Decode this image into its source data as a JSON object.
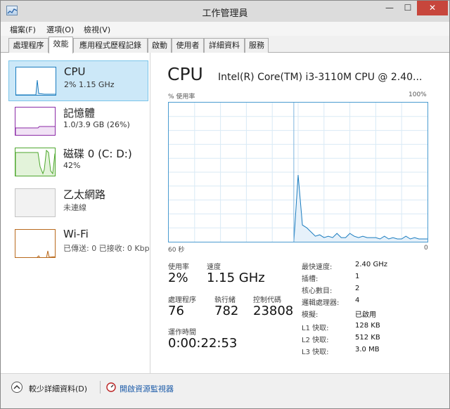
{
  "window": {
    "title": "工作管理員",
    "min_glyph": "—",
    "max_glyph": "☐",
    "close_glyph": "✕"
  },
  "menu": [
    "檔案(F)",
    "選項(O)",
    "檢視(V)"
  ],
  "tabs": [
    {
      "label": "處理程序",
      "active": false
    },
    {
      "label": "效能",
      "active": true
    },
    {
      "label": "應用程式歷程記錄",
      "active": false
    },
    {
      "label": "啟動",
      "active": false
    },
    {
      "label": "使用者",
      "active": false
    },
    {
      "label": "詳細資料",
      "active": false
    },
    {
      "label": "服務",
      "active": false
    }
  ],
  "resources": [
    {
      "name": "CPU",
      "detail": "2% 1.15 GHz",
      "color": "#1a7cbf",
      "selected": true
    },
    {
      "name": "記憶體",
      "detail": "1.0/3.9 GB (26%)",
      "color": "#8b2aa6",
      "selected": false
    },
    {
      "name": "磁碟 0 (C: D:)",
      "detail": "42%",
      "color": "#4ea72e",
      "selected": false
    },
    {
      "name": "乙太網路",
      "detail": "未連線",
      "color": "#999999",
      "selected": false
    },
    {
      "name": "Wi-Fi",
      "detail": "已傳送: 0 已接收: 0 Kbps",
      "color": "#b96a1d",
      "selected": false
    }
  ],
  "main": {
    "title": "CPU",
    "model": "Intel(R) Core(TM) i3-3110M CPU @ 2.40...",
    "y_axis_label": "% 使用率",
    "y_max_label": "100%",
    "x_left_label": "60 秒",
    "x_right_label": "0",
    "graph_color": "#1a7cbf"
  },
  "stats": {
    "usage_label": "使用率",
    "usage_value": "2%",
    "speed_label": "速度",
    "speed_value": "1.15 GHz",
    "processes_label": "處理程序",
    "processes_value": "76",
    "threads_label": "執行緒",
    "threads_value": "782",
    "handles_label": "控制代碼",
    "handles_value": "23808",
    "uptime_label": "運作時間",
    "uptime_value": "0:00:22:53"
  },
  "specs": [
    {
      "label": "最快速度:",
      "value": "2.40 GHz"
    },
    {
      "label": "插槽:",
      "value": "1"
    },
    {
      "label": "核心數目:",
      "value": "2"
    },
    {
      "label": "邏輯處理器:",
      "value": "4"
    },
    {
      "label": "模擬:",
      "value": "已啟用"
    },
    {
      "label": "L1 快取:",
      "value": "128 KB"
    },
    {
      "label": "L2 快取:",
      "value": "512 KB"
    },
    {
      "label": "L3 快取:",
      "value": "3.0 MB"
    }
  ],
  "footer": {
    "fewer_details": "較少詳細資料(D)",
    "open_monitor": "開啟資源監視器"
  },
  "chart_data": {
    "type": "area",
    "xlabel": "",
    "ylabel": "% 使用率",
    "xlim": [
      60,
      0
    ],
    "ylim": [
      0,
      100
    ],
    "grid": true,
    "series": [
      {
        "x": [
          60,
          59,
          58,
          57,
          56,
          55,
          54,
          53,
          52,
          51,
          50,
          49,
          48,
          47,
          46,
          45,
          44,
          43,
          42,
          41,
          40,
          39,
          38,
          37,
          36,
          35,
          34,
          33,
          32,
          31,
          30,
          29,
          28,
          27,
          26,
          25,
          24,
          23,
          22,
          21,
          20,
          19,
          18,
          17,
          16,
          15,
          14,
          13,
          12,
          11,
          10,
          9,
          8,
          7,
          6,
          5,
          4,
          3,
          2,
          1,
          0
        ],
        "values": [
          0,
          0,
          0,
          0,
          0,
          0,
          0,
          0,
          0,
          0,
          0,
          0,
          0,
          0,
          0,
          0,
          0,
          0,
          0,
          0,
          0,
          0,
          0,
          0,
          0,
          0,
          0,
          0,
          0,
          0,
          48,
          12,
          10,
          7,
          4,
          5,
          3,
          4,
          3,
          6,
          3,
          3,
          6,
          4,
          3,
          4,
          3,
          3,
          3,
          2,
          4,
          2,
          3,
          2,
          2,
          4,
          2,
          3,
          2,
          2,
          2
        ]
      }
    ]
  }
}
